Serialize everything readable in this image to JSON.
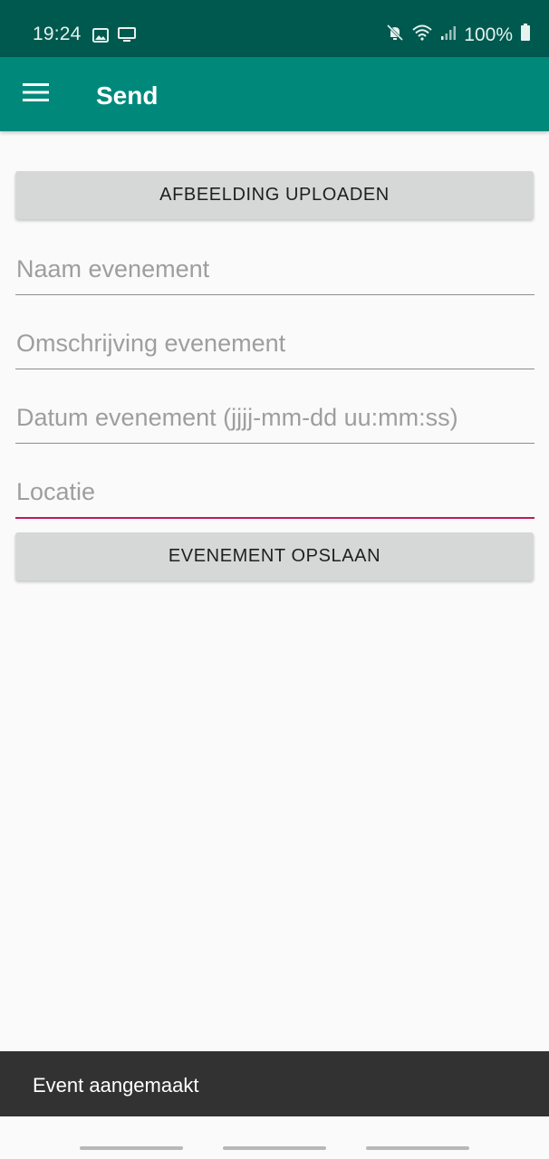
{
  "status_bar": {
    "time": "19:24",
    "battery_text": "100%",
    "icons": [
      "image-icon",
      "cast-screen-icon",
      "mute-icon",
      "wifi-icon",
      "signal-icon",
      "battery-icon"
    ]
  },
  "app_bar": {
    "title": "Send",
    "menu_icon": "hamburger-menu-icon",
    "background": "#00897b"
  },
  "upload_button": {
    "label": "AFBEELDING UPLOADEN"
  },
  "form": {
    "name_field": {
      "placeholder": "Naam evenement",
      "value": ""
    },
    "description_field": {
      "placeholder": "Omschrijving evenement",
      "value": ""
    },
    "date_field": {
      "placeholder": "Datum evenement (jjjj-mm-dd uu:mm:ss)",
      "value": ""
    },
    "location_field": {
      "placeholder": "Locatie",
      "value": "",
      "focused": true
    }
  },
  "save_button": {
    "label": "EVENEMENT OPSLAAN"
  },
  "snackbar": {
    "message": "Event aangemaakt"
  },
  "colors": {
    "status_bar": "#00594f",
    "accent_focus": "#c2185b",
    "button_bg": "#d6d7d7"
  }
}
